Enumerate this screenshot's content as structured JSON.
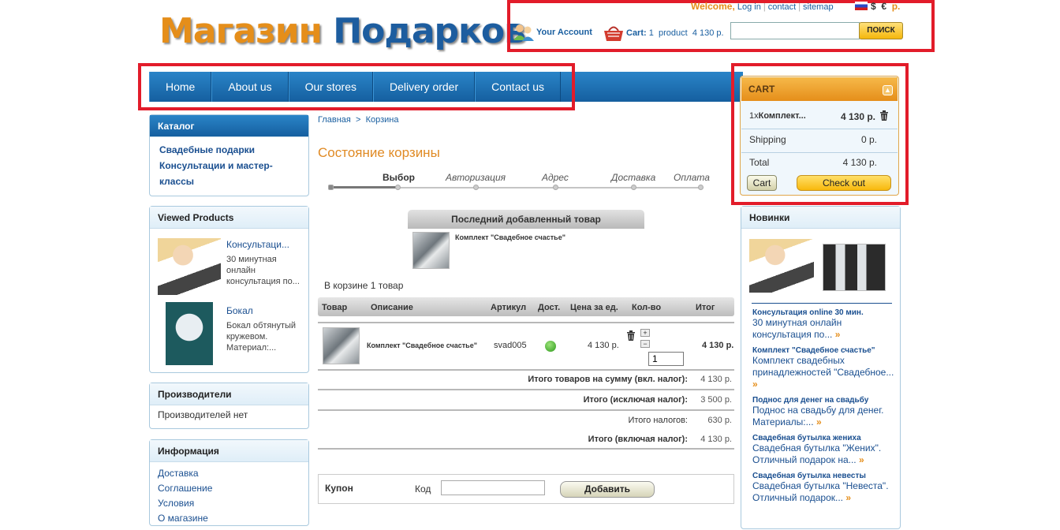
{
  "header": {
    "logo_word1": "Магазин",
    "logo_word2": "Подарков",
    "welcome": "Welcome,",
    "links": [
      "Log in",
      "contact",
      "sitemap"
    ],
    "currencies": [
      "$",
      "€",
      "р."
    ],
    "account": "Your Account",
    "cart_label": "Cart:",
    "cart_count": "1",
    "cart_product": "product",
    "cart_total": "4 130 р.",
    "search_button": "ПОИСК",
    "search_value": ""
  },
  "nav": [
    "Home",
    "About us",
    "Our stores",
    "Delivery order",
    "Contact us"
  ],
  "left": {
    "catalog_title": "Каталог",
    "catalog_items": [
      "Свадебные подарки",
      "Консультации и мастер-классы"
    ],
    "viewed_title": "Viewed Products",
    "viewed": [
      {
        "name": "Консультаци...",
        "desc": "30 минутная онлайн консультация по..."
      },
      {
        "name": "Бокал",
        "desc": "Бокал обтянутый кружевом. Материал:..."
      }
    ],
    "manuf_title": "Производители",
    "manuf_text": "Производителей нет",
    "info_title": "Информация",
    "info_items": [
      "Доставка",
      "Соглашение",
      "Условия",
      "О магазине"
    ]
  },
  "content": {
    "breadcrumb_home": "Главная",
    "breadcrumb_sep": ">",
    "breadcrumb_current": "Корзина",
    "title": "Состояние корзины",
    "steps": [
      "Выбор",
      "Авторизация",
      "Адрес",
      "Доставка",
      "Оплата"
    ],
    "last_added_title": "Последний добавленный товар",
    "last_added_name": "Комплект \"Свадебное счастье\"",
    "in_cart_text": "В корзине 1 товар",
    "table_headers": [
      "Товар",
      "Описание",
      "Артикул",
      "Дост.",
      "Цена за ед.",
      "Кол-во",
      "Итог"
    ],
    "row": {
      "name": "Комплект \"Свадебное счастье\"",
      "sku": "svad005",
      "price": "4 130 р.",
      "qty": "1",
      "total": "4 130 р."
    },
    "summary": [
      {
        "label": "Итого товаров на сумму (вкл. налог):",
        "value": "4 130 р."
      },
      {
        "label": "Итого (исключая налог):",
        "value": "3 500 р."
      },
      {
        "label": "Итого налогов:",
        "value": "630 р."
      },
      {
        "label": "Итого (включая налог):",
        "value": "4 130 р."
      }
    ],
    "coupon_label": "Купон",
    "code_label": "Код",
    "coupon_button": "Добавить"
  },
  "cart_block": {
    "title": "CART",
    "item_qty": "1x",
    "item_name": "Комплект...",
    "item_price": "4 130 р.",
    "shipping_label": "Shipping",
    "shipping_value": "0 р.",
    "total_label": "Total",
    "total_value": "4 130 р.",
    "cart_button": "Cart",
    "checkout_button": "Check out"
  },
  "new_block": {
    "title": "Новинки",
    "items": [
      {
        "title": "Консультация online 30 мин.",
        "desc": "30 минутная онлайн консультация по..."
      },
      {
        "title": "Комплект \"Свадебное счастье\"",
        "desc": "Комплект свадебных принадлежностей \"Свадебное..."
      },
      {
        "title": "Поднос для денег на свадьбу",
        "desc": "Поднос на свадьбу для денег. Материалы:..."
      },
      {
        "title": "Свадебная бутылка жениха",
        "desc": "Свадебная бутылка \"Жених\". Отличный подарок на..."
      },
      {
        "title": "Свадебная бутылка невесты",
        "desc": "Свадебная бутылка \"Невеста\". Отличный подарок..."
      }
    ]
  }
}
